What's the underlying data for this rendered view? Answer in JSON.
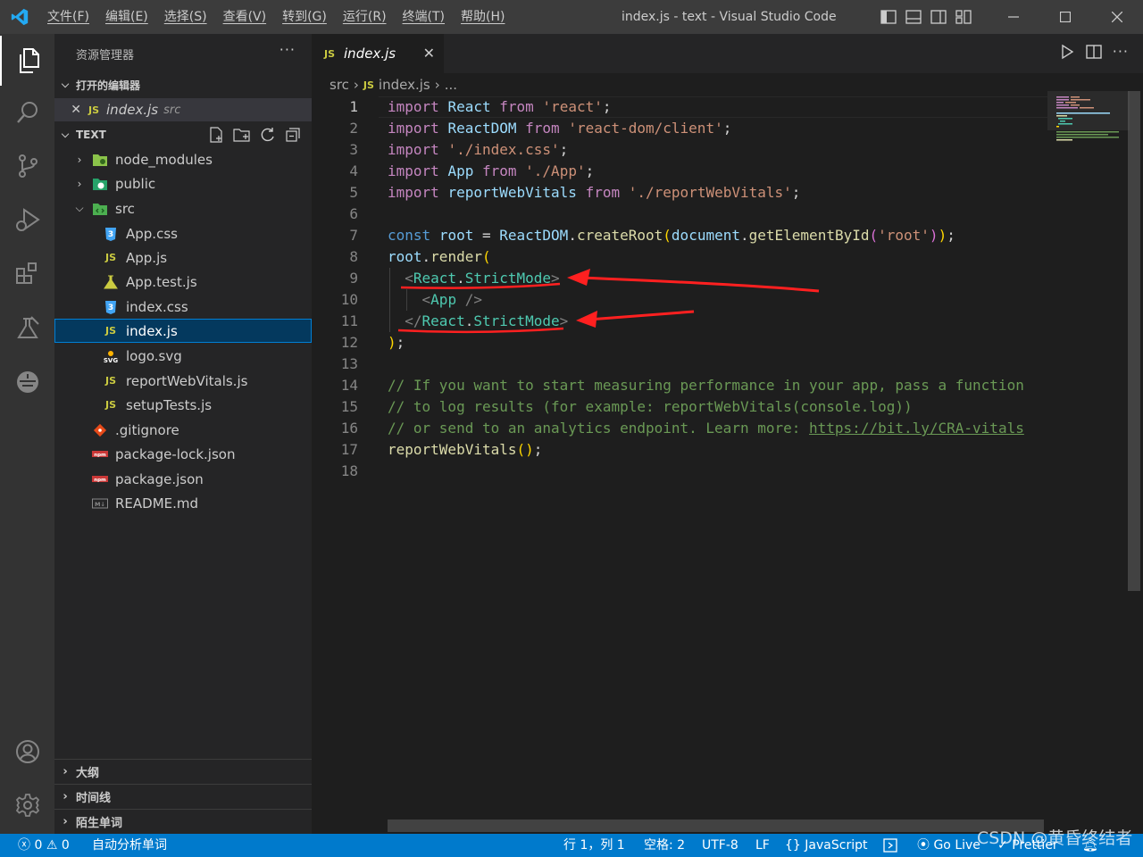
{
  "titlebar": {
    "menus": [
      "文件(F)",
      "编辑(E)",
      "选择(S)",
      "查看(V)",
      "转到(G)",
      "运行(R)",
      "终端(T)",
      "帮助(H)"
    ],
    "title": "index.js - text - Visual Studio Code"
  },
  "activity_bar": {
    "icons": [
      "explorer-icon",
      "search-icon",
      "source-control-icon",
      "run-debug-icon",
      "extensions-icon",
      "testing-icon",
      "remote-icon",
      "accounts-icon",
      "settings-gear-icon"
    ]
  },
  "sidebar": {
    "title": "资源管理器",
    "more": "···",
    "open_editors_label": "打开的编辑器",
    "open_editor": {
      "name": "index.js",
      "folder": "src",
      "badge": "JS"
    },
    "folder_label": "TEXT",
    "tree": [
      {
        "name": "node_modules",
        "kind": "folder",
        "icon": "node-modules-folder-icon"
      },
      {
        "name": "public",
        "kind": "folder",
        "icon": "public-folder-icon"
      },
      {
        "name": "src",
        "kind": "folder-open",
        "icon": "src-folder-icon"
      },
      {
        "name": "App.css",
        "kind": "file",
        "icon": "css-file-icon"
      },
      {
        "name": "App.js",
        "kind": "file",
        "icon": "js-file-icon"
      },
      {
        "name": "App.test.js",
        "kind": "file",
        "icon": "test-file-icon"
      },
      {
        "name": "index.css",
        "kind": "file",
        "icon": "css-file-icon"
      },
      {
        "name": "index.js",
        "kind": "file",
        "icon": "js-file-icon"
      },
      {
        "name": "logo.svg",
        "kind": "file",
        "icon": "svg-file-icon"
      },
      {
        "name": "reportWebVitals.js",
        "kind": "file",
        "icon": "js-file-icon"
      },
      {
        "name": "setupTests.js",
        "kind": "file",
        "icon": "js-file-icon"
      },
      {
        "name": ".gitignore",
        "kind": "file",
        "icon": "git-file-icon"
      },
      {
        "name": "package-lock.json",
        "kind": "file",
        "icon": "npm-file-icon"
      },
      {
        "name": "package.json",
        "kind": "file",
        "icon": "npm-file-icon"
      },
      {
        "name": "README.md",
        "kind": "file",
        "icon": "markdown-file-icon"
      }
    ],
    "bottom_sections": [
      "大纲",
      "时间线",
      "陌生单词"
    ]
  },
  "editor": {
    "tab": {
      "badge": "JS",
      "name": "index.js",
      "close": "✕"
    },
    "breadcrumb": {
      "folder": "src",
      "badge": "JS",
      "file": "index.js",
      "more": "..."
    },
    "line_numbers": [
      "1",
      "2",
      "3",
      "4",
      "5",
      "6",
      "7",
      "8",
      "9",
      "10",
      "11",
      "12",
      "13",
      "14",
      "15",
      "16",
      "17",
      "18"
    ],
    "current_line": "1",
    "code_lines": [
      "import React from 'react';",
      "import ReactDOM from 'react-dom/client';",
      "import './index.css';",
      "import App from './App';",
      "import reportWebVitals from './reportWebVitals';",
      "",
      "const root = ReactDOM.createRoot(document.getElementById('root'));",
      "root.render(",
      "  <React.StrictMode>",
      "    <App />",
      "  </React.StrictMode>",
      ");",
      "",
      "// If you want to start measuring performance in your app, pass a function",
      "// to log results (for example: reportWebVitals(console.log))",
      "// or send to an analytics endpoint. Learn more: https://bit.ly/CRA-vitals",
      "reportWebVitals();",
      ""
    ]
  },
  "statusbar": {
    "errors": "0",
    "warnings": "0",
    "auto_analyze": "自动分析单词",
    "cursor": "行 1，列 1",
    "indent": "空格: 2",
    "encoding": "UTF-8",
    "eol": "LF",
    "language": "JavaScript",
    "golive": "Go Live",
    "prettier": "Prettier"
  },
  "watermark": "CSDN @黄昏终结者",
  "colors": {
    "titlebar": "#3c3c3c",
    "activitybar": "#333333",
    "sidebar": "#252526",
    "editor": "#1e1e1e",
    "statusbar": "#007acc",
    "selection": "#04395e",
    "annotation": "#ff2020"
  }
}
